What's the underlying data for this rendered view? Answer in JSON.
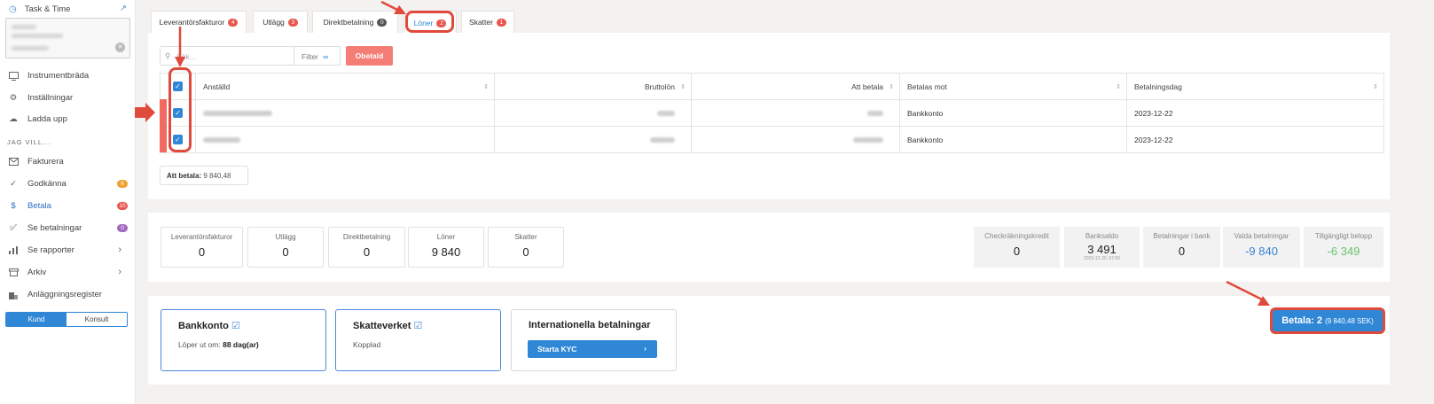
{
  "sidebar": {
    "app_title": "Task & Time",
    "items": [
      {
        "label": "Instrumentbräda",
        "icon": "monitor-icon"
      },
      {
        "label": "Inställningar",
        "icon": "gear-icon"
      },
      {
        "label": "Ladda upp",
        "icon": "cloud-upload-icon"
      },
      {
        "label": "Fakturera",
        "icon": "mail-icon"
      },
      {
        "label": "Godkänna",
        "icon": "check-icon",
        "badge": "6"
      },
      {
        "label": "Betala",
        "icon": "dollar-icon",
        "badge": "10"
      },
      {
        "label": "Se betalningar",
        "icon": "check-circle-icon",
        "badge": "0"
      },
      {
        "label": "Se rapporter",
        "icon": "bar-chart-icon"
      },
      {
        "label": "Arkiv",
        "icon": "archive-icon"
      },
      {
        "label": "Anläggningsregister",
        "icon": "building-icon"
      }
    ],
    "section_label": "JAG VILL...",
    "toggle": {
      "left": "Kund",
      "right": "Konsult"
    }
  },
  "tabs": [
    {
      "label": "Leverantörsfakturor",
      "badge": "4"
    },
    {
      "label": "Utlägg",
      "badge": "3"
    },
    {
      "label": "Direktbetalning",
      "badge": "0"
    },
    {
      "label": "Löner",
      "badge": "2"
    },
    {
      "label": "Skatter",
      "badge": "1"
    }
  ],
  "toolbar": {
    "search_placeholder": "Sök...",
    "filter": "Filter",
    "obetald": "Obetald"
  },
  "table": {
    "headers": [
      "Anställd",
      "Bruttolön",
      "Att betala",
      "Betalas mot",
      "Betalningsdag"
    ],
    "rows": [
      {
        "betalas_mot": "Bankkonto",
        "dag": "2023-12-22"
      },
      {
        "betalas_mot": "Bankkonto",
        "dag": "2023-12-22"
      }
    ]
  },
  "total": {
    "label": "Att betala:",
    "value": "9 840,48"
  },
  "summary": [
    {
      "label": "Leverantörsfakturor",
      "value": "0"
    },
    {
      "label": "Utlägg",
      "value": "0"
    },
    {
      "label": "Direktbetalning",
      "value": "0"
    },
    {
      "label": "Löner",
      "value": "9 840"
    },
    {
      "label": "Skatter",
      "value": "0"
    }
  ],
  "bank_summary": [
    {
      "label": "Checkräkningskredit",
      "value": "0",
      "color": "#222222"
    },
    {
      "label": "Banksaldo",
      "value": "3 491",
      "sub": "2023-12-20, 07:00",
      "color": "#222222"
    },
    {
      "label": "Betalningar i bank",
      "value": "0",
      "color": "#222222"
    },
    {
      "label": "Valda betalningar",
      "value": "-9 840",
      "color": "#3a82d4"
    },
    {
      "label": "Tillgängligt belopp",
      "value": "-6 349",
      "color": "#6cc070"
    }
  ],
  "bottom": {
    "bank": {
      "title": "Bankkonto",
      "text_pre": "Löper ut om:",
      "text_bold": "88 dag(ar)"
    },
    "skatt": {
      "title": "Skatteverket",
      "text": "Kopplad"
    },
    "intl": {
      "title": "Internationella betalningar",
      "button": "Starta KYC"
    }
  },
  "pay_button": {
    "label": "Betala: 2",
    "amount": "(9 840,48 SEK)"
  },
  "colors": {
    "accent": "#2f87d6",
    "annotation": "#e04a3c",
    "badge_red": "#e8574f"
  }
}
